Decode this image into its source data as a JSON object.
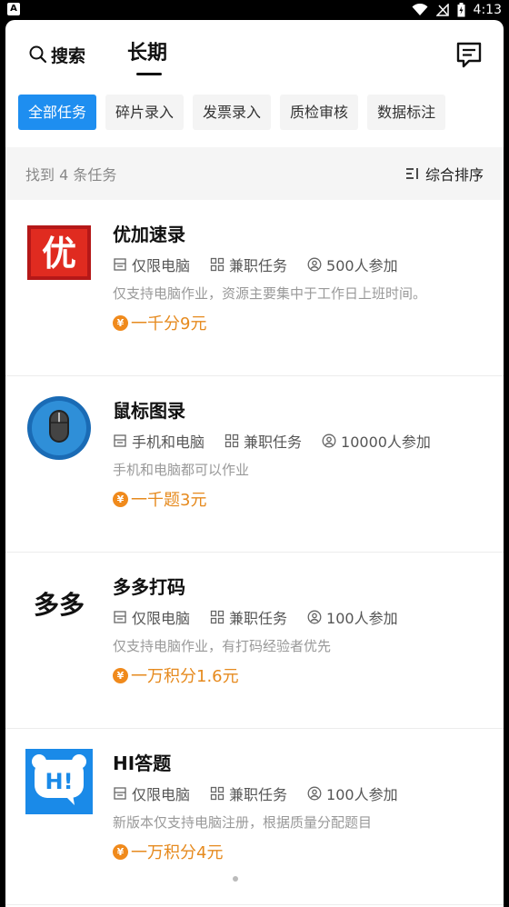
{
  "status_bar": {
    "time": "4:13",
    "app_badge": "A",
    "battery_level": "B"
  },
  "header": {
    "search_label": "搜索",
    "active_tab": "长期",
    "accent_color": "#1e8ef0"
  },
  "filters": [
    {
      "label": "全部任务",
      "active": true
    },
    {
      "label": "碎片录入",
      "active": false
    },
    {
      "label": "发票录入",
      "active": false
    },
    {
      "label": "质检审核",
      "active": false
    },
    {
      "label": "数据标注",
      "active": false
    }
  ],
  "results": {
    "text": "找到 4 条任务",
    "sort_label": "综合排序"
  },
  "tasks": [
    {
      "title": "优加速录",
      "logo_text": "优",
      "device": "仅限电脑",
      "type": "兼职任务",
      "participants": "500人参加",
      "description": "仅支持电脑作业，资源主要集中于工作日上班时间。",
      "reward": "一千分9元"
    },
    {
      "title": "鼠标图录",
      "logo_text": "",
      "device": "手机和电脑",
      "type": "兼职任务",
      "participants": "10000人参加",
      "description": "手机和电脑都可以作业",
      "reward": "一千题3元"
    },
    {
      "title": "多多打码",
      "logo_text": "多多",
      "device": "仅限电脑",
      "type": "兼职任务",
      "participants": "100人参加",
      "description": "仅支持电脑作业，有打码经验者优先",
      "reward": "一万积分1.6元"
    },
    {
      "title": "HI答题",
      "logo_text": "H!",
      "device": "仅限电脑",
      "type": "兼职任务",
      "participants": "100人参加",
      "description": "新版本仅支持电脑注册，根据质量分配题目",
      "reward": "一万积分4元"
    }
  ],
  "coin_symbol": "¥"
}
